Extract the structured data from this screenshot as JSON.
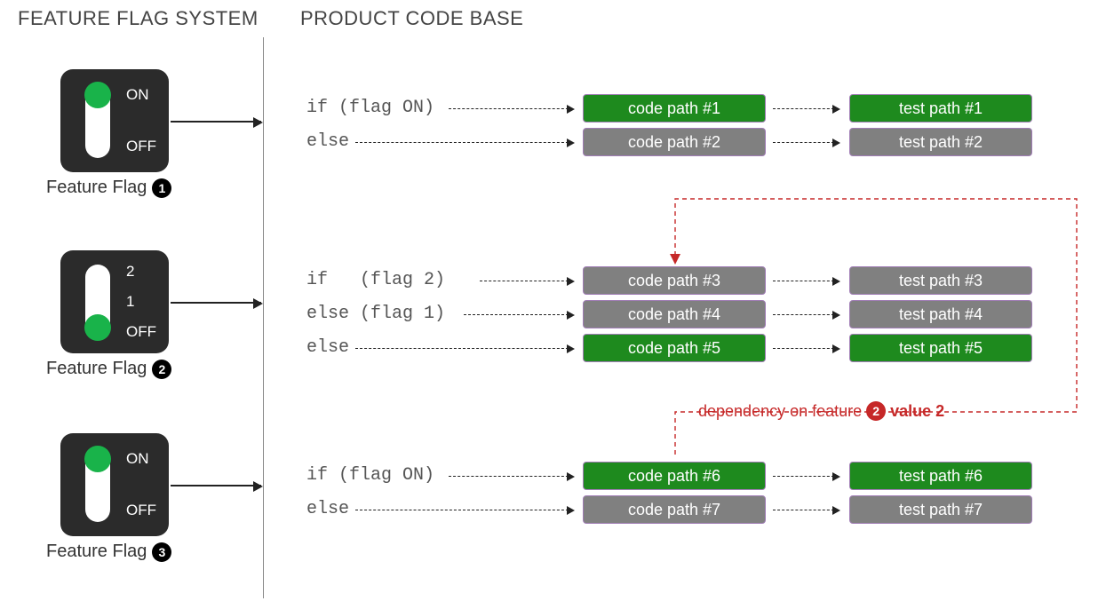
{
  "headings": {
    "left": "FEATURE FLAG SYSTEM",
    "right": "PRODUCT CODE BASE"
  },
  "flags": {
    "f1": {
      "caption": "Feature Flag",
      "num": "1",
      "labels": [
        "ON",
        "OFF"
      ]
    },
    "f2": {
      "caption": "Feature Flag",
      "num": "2",
      "labels": [
        "2",
        "1",
        "OFF"
      ]
    },
    "f3": {
      "caption": "Feature Flag",
      "num": "3",
      "labels": [
        "ON",
        "OFF"
      ]
    }
  },
  "rows": {
    "r1": {
      "cond": "if (flag ON)",
      "code": "code path #1",
      "test": "test path #1"
    },
    "r2": {
      "cond": "else",
      "code": "code path #2",
      "test": "test path #2"
    },
    "r3": {
      "cond": "if   (flag 2)",
      "code": "code path #3",
      "test": "test path #3"
    },
    "r4": {
      "cond": "else (flag 1)",
      "code": "code path #4",
      "test": "test path #4"
    },
    "r5": {
      "cond": "else",
      "code": "code path #5",
      "test": "test path #5"
    },
    "r6": {
      "cond": "if (flag ON)",
      "code": "code path #6",
      "test": "test path #6"
    },
    "r7": {
      "cond": "else",
      "code": "code path #7",
      "test": "test path #7"
    }
  },
  "dependency": {
    "prefix": "dependency on feature",
    "flag": "2",
    "suffix": "value 2"
  }
}
